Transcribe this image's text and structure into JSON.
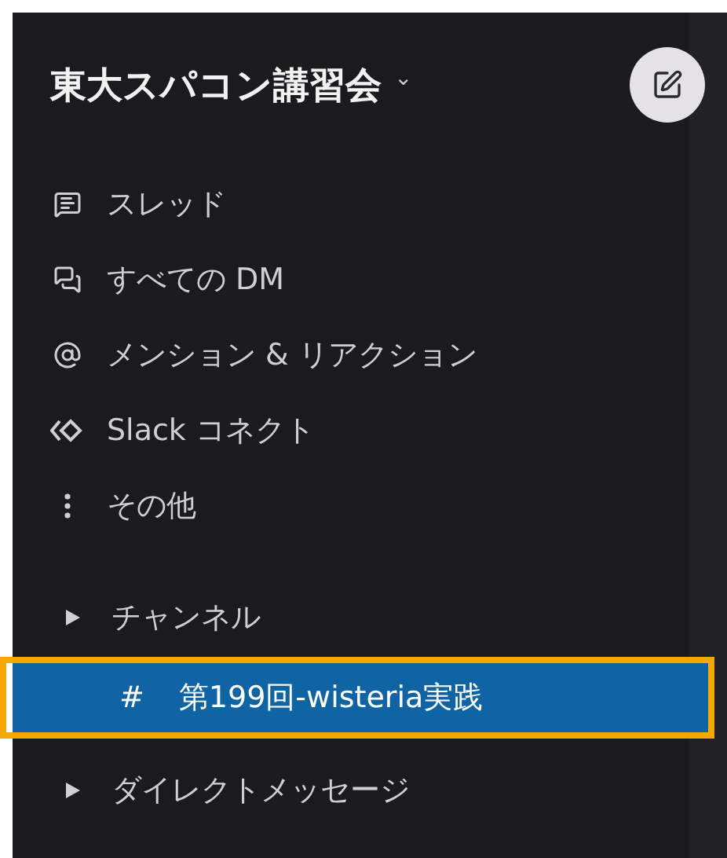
{
  "workspace": {
    "name": "東大スパコン講習会",
    "caret": "⌄"
  },
  "nav_items": [
    {
      "kind": "thread",
      "label": "スレッド",
      "selected": false
    },
    {
      "kind": "dm",
      "label": "すべての DM",
      "selected": false
    },
    {
      "kind": "mention",
      "label": "メンション & リアクション",
      "selected": false
    },
    {
      "kind": "connect",
      "label": "Slack コネクト",
      "selected": false
    },
    {
      "kind": "more",
      "label": "その他",
      "selected": false
    }
  ],
  "sections": [
    {
      "label": "チャンネル",
      "expanded": false,
      "channels": [
        {
          "prefix": "#",
          "name": "第199回-wisteria実践",
          "selected": true,
          "highlighted": true
        }
      ]
    },
    {
      "label": "ダイレクトメッセージ",
      "expanded": false
    }
  ]
}
